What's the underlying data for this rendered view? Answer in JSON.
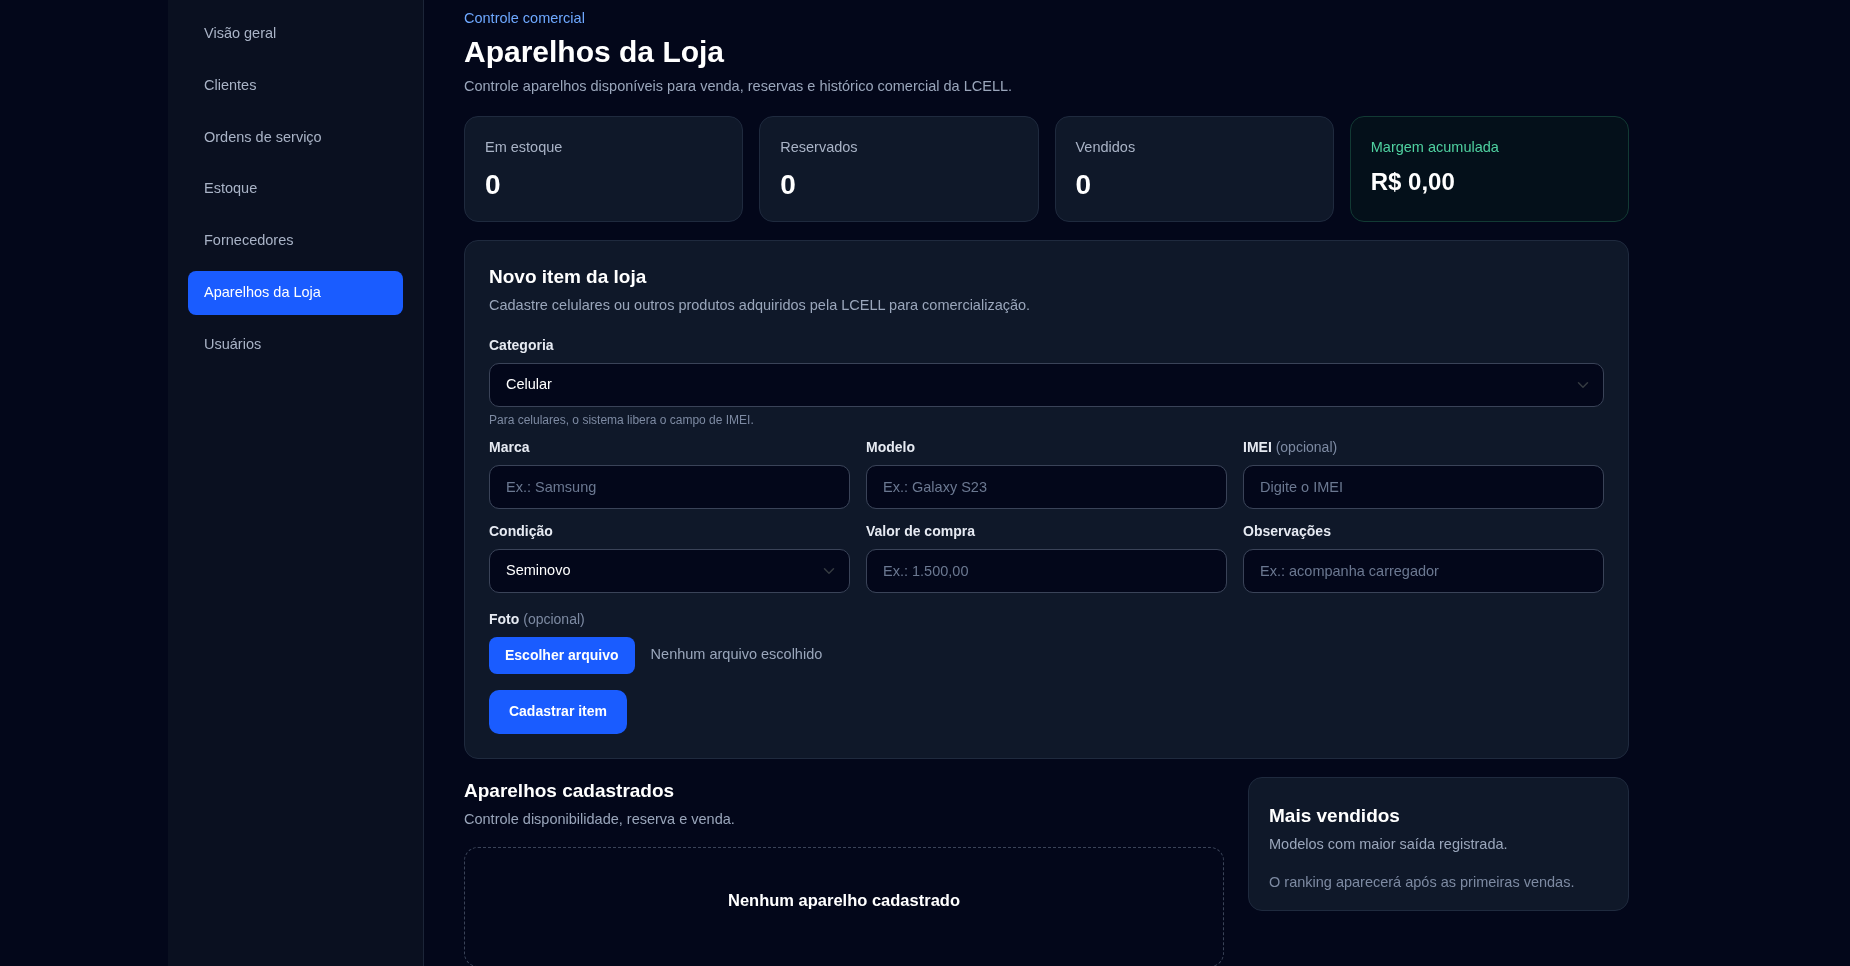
{
  "sidebar": {
    "items": [
      {
        "label": "Visão geral",
        "selected": false
      },
      {
        "label": "Clientes",
        "selected": false
      },
      {
        "label": "Ordens de serviço",
        "selected": false
      },
      {
        "label": "Estoque",
        "selected": false
      },
      {
        "label": "Fornecedores",
        "selected": false
      },
      {
        "label": "Aparelhos da Loja",
        "selected": true
      },
      {
        "label": "Usuários",
        "selected": false
      }
    ]
  },
  "header": {
    "eyebrow": "Controle comercial",
    "title": "Aparelhos da Loja",
    "subtitle": "Controle aparelhos disponíveis para venda, reservas e histórico comercial da LCELL."
  },
  "stats": [
    {
      "label": "Em estoque",
      "value": "0",
      "kind": "plain"
    },
    {
      "label": "Reservados",
      "value": "0",
      "kind": "plain"
    },
    {
      "label": "Vendidos",
      "value": "0",
      "kind": "plain"
    },
    {
      "label": "Margem acumulada",
      "value": "R$ 0,00",
      "kind": "accent"
    }
  ],
  "form": {
    "title": "Novo item da loja",
    "subtitle": "Cadastre celulares ou outros produtos adquiridos pela LCELL para comercialização.",
    "category": {
      "label": "Categoria",
      "value": "Celular",
      "help": "Para celulares, o sistema libera o campo de IMEI."
    },
    "fields": [
      {
        "label": "Marca",
        "kind": "input",
        "placeholder": "Ex.: Samsung"
      },
      {
        "label": "Modelo",
        "kind": "input",
        "placeholder": "Ex.: Galaxy S23"
      },
      {
        "label": "IMEI",
        "hint": "(opcional)",
        "kind": "input",
        "placeholder": "Digite o IMEI"
      },
      {
        "label": "Condição",
        "kind": "select",
        "value": "Seminovo"
      },
      {
        "label": "Valor de compra",
        "kind": "input",
        "placeholder": "Ex.: 1.500,00"
      },
      {
        "label": "Observações",
        "kind": "input",
        "placeholder": "Ex.: acompanha carregador"
      }
    ],
    "photo": {
      "label": "Foto",
      "hint": "(opcional)",
      "button": "Escolher arquivo",
      "status": "Nenhum arquivo escolhido"
    },
    "submit": "Cadastrar item"
  },
  "devices": {
    "title": "Aparelhos cadastrados",
    "subtitle": "Controle disponibilidade, reserva e venda.",
    "empty_title": "Nenhum aparelho cadastrado"
  },
  "best_sellers": {
    "title": "Mais vendidos",
    "subtitle": "Modelos com maior saída registrada.",
    "empty": "O ranking aparecerá após as primeiras vendas."
  }
}
